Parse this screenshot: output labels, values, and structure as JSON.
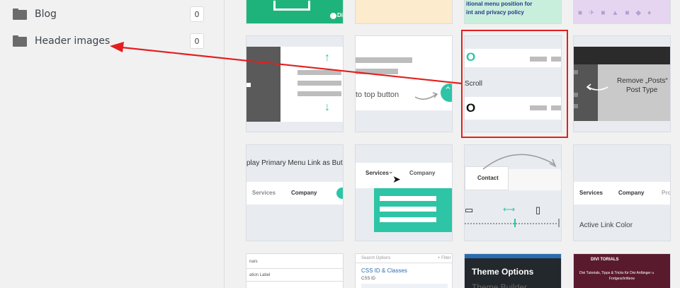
{
  "sidebar": {
    "folders": [
      {
        "name": "Blog",
        "count": "0"
      },
      {
        "name": "Header images",
        "count": "0"
      }
    ]
  },
  "tiles": {
    "row0": {
      "purple_title_line1": "itional menu position for",
      "purple_title_line2": "int and privacy policy",
      "green_logo": "Di"
    },
    "row1": {
      "back_to_top_label": "to top button",
      "scroll_label": "Scroll",
      "remove_posts_line1": "Remove „Posts“",
      "remove_posts_line2": "Post Type"
    },
    "row2": {
      "primary_menu_label": "play Primary Menu Link as But",
      "services_label": "Services",
      "company_label": "Company",
      "dropdown_services": "Services",
      "dropdown_company": "Company",
      "contact_label": "Contact",
      "active_services": "Services",
      "active_company": "Company",
      "active_pro": "Pro",
      "active_link_color": "Active Link Color"
    },
    "row3": {
      "table_col1": "nars",
      "table_col2": "ation Label",
      "search_options": "Search Options",
      "filter_label": "+ Filter",
      "css_id_classes": "CSS ID & Classes",
      "css_id": "CSS ID",
      "theme_options": "Theme Options",
      "theme_builder": "Theme Builder",
      "divi_tutorials": "DIVI TORIALS",
      "divi_line1": "Divi Tutorials, Tipps & Tricks für Divi Anfänger u",
      "divi_line2": "Fortgeschrittene"
    }
  },
  "colors": {
    "accent_teal": "#2ec4a6",
    "highlight_red": "#e41e1e",
    "dark_navy": "#23282d",
    "purple_bg": "#e6d5f0"
  }
}
